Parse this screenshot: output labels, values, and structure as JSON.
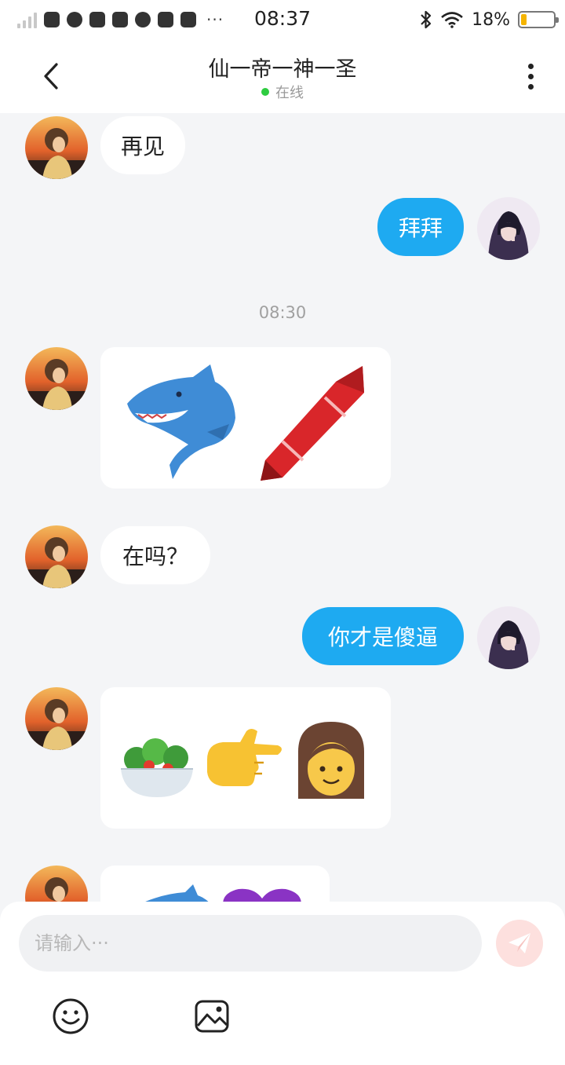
{
  "status_bar": {
    "time": "08:37",
    "battery_label": "18%",
    "battery_level": 0.18,
    "overflow": "···"
  },
  "header": {
    "title": "仙一帝一神一圣",
    "status": "在线"
  },
  "messages": [
    {
      "from": "contact",
      "type": "text",
      "text": "再见"
    },
    {
      "from": "me",
      "type": "text",
      "text": "拜拜"
    },
    {
      "type": "timestamp",
      "text": "08:30"
    },
    {
      "from": "contact",
      "type": "emoji",
      "icons": [
        "shark",
        "crayon"
      ],
      "text": "🦈🖍"
    },
    {
      "from": "contact",
      "type": "text",
      "text": "在吗？"
    },
    {
      "from": "me",
      "type": "text",
      "text": "你才是傻逼"
    },
    {
      "from": "contact",
      "type": "emoji",
      "icons": [
        "salad",
        "pointing-right",
        "woman"
      ],
      "text": "🥗👉👩"
    },
    {
      "from": "contact",
      "type": "emoji",
      "icons": [
        "shark",
        "purple-heart"
      ],
      "text": "🦈💜"
    }
  ],
  "composer": {
    "placeholder": "请输入···",
    "icons": [
      "emoji-icon",
      "image-icon",
      "send-icon"
    ]
  },
  "colors": {
    "accent": "#1eaaf1",
    "online": "#2ecc40",
    "send": "#fde0de",
    "battery": "#f5b400"
  }
}
